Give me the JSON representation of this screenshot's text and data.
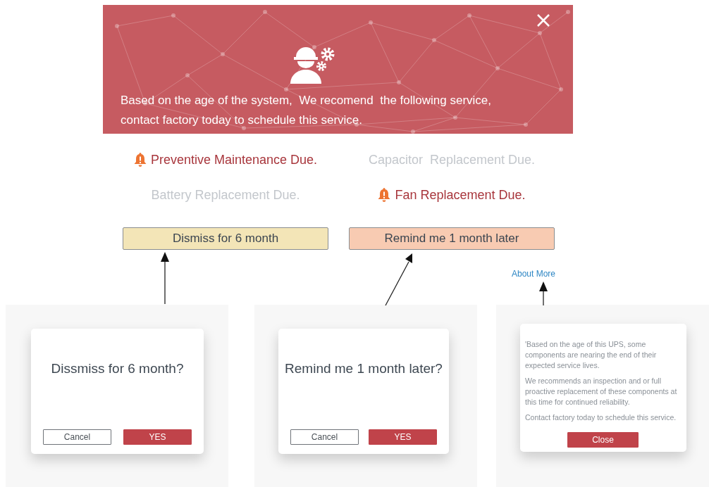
{
  "banner": {
    "message": "Based on the age of the system,  We recomend  the following service, contact factory today to schedule this service."
  },
  "alerts": [
    {
      "label": "Preventive Maintenance Due.",
      "due": true
    },
    {
      "label": "Capacitor  Replacement Due.",
      "due": false
    },
    {
      "label": "Battery Replacement Due.",
      "due": false
    },
    {
      "label": "Fan Replacement Due.",
      "due": true
    }
  ],
  "actions": [
    {
      "label": "Dismiss for 6 month",
      "kind": "dismiss"
    },
    {
      "label": "Remind me 1 month later",
      "kind": "remind"
    }
  ],
  "about_link": "About More",
  "dialogs": [
    {
      "kind": "confirm",
      "question": "Dissmiss for 6 month?",
      "buttons": [
        {
          "label": "Cancel",
          "kind": "secondary"
        },
        {
          "label": "YES",
          "kind": "primary"
        }
      ]
    },
    {
      "kind": "confirm",
      "question": "Remind me 1 month later?",
      "buttons": [
        {
          "label": "Cancel",
          "kind": "secondary"
        },
        {
          "label": "YES",
          "kind": "primary"
        }
      ]
    },
    {
      "kind": "info",
      "paragraphs": [
        "'Based on the age of this UPS, some components are nearing the end of their expected service lives.",
        "We recommends an inspection and or full proactive replacement of these components  at this time for continued reliability.",
        "Contact factory today to schedule this service."
      ],
      "buttons": [
        {
          "label": "Close",
          "kind": "primary"
        }
      ]
    }
  ]
}
